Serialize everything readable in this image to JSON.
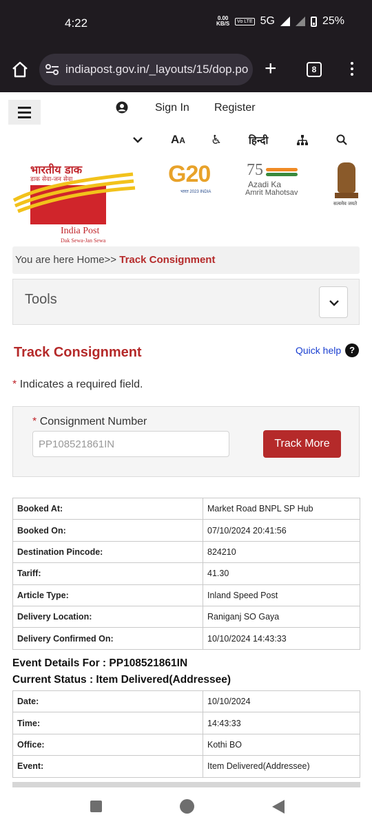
{
  "status_bar": {
    "time": "4:22",
    "speed_value": "0.00",
    "speed_unit": "KB/S",
    "volte": "Vo LTE",
    "network": "5G",
    "battery": "25%"
  },
  "browser": {
    "url": "indiapost.gov.in/_layouts/15/dop.po",
    "tab_count": "8"
  },
  "header": {
    "sign_in": "Sign In",
    "register": "Register",
    "hindi": "हिन्दी",
    "font_icon": "A",
    "access_icon": "♿"
  },
  "logos": {
    "hindi_title": "भारतीय डाक",
    "hindi_tagline": "डाक सेवा-जन सेवा",
    "name": "India Post",
    "tagline": "Dak Sewa-Jan Sewa",
    "g20": "G20",
    "g20_sub": "भारत 2023 INDIA",
    "azadi_75": "75",
    "azadi_line1": "Azadi Ka",
    "azadi_line2": "Amrit Mahotsav",
    "emblem_text": "सत्यमेव जयते"
  },
  "breadcrumb": {
    "prefix": "You are here",
    "home": "Home",
    "sep": ">>",
    "current": "Track Consignment"
  },
  "tools": {
    "label": "Tools"
  },
  "page": {
    "title": "Track Consignment",
    "quick_help": "Quick help",
    "help_glyph": "?",
    "required_star": "*",
    "required_note": "Indicates a required field."
  },
  "form": {
    "star": "*",
    "label": "Consignment Number",
    "value": "PP108521861IN",
    "button": "Track More"
  },
  "booking_rows": [
    {
      "key": "Booked At:",
      "value": "Market Road BNPL SP Hub"
    },
    {
      "key": "Booked On:",
      "value": "07/10/2024 20:41:56"
    },
    {
      "key": "Destination Pincode:",
      "value": "824210"
    },
    {
      "key": "Tariff:",
      "value": "41.30"
    },
    {
      "key": "Article Type:",
      "value": "Inland Speed Post"
    },
    {
      "key": "Delivery Location:",
      "value": "Raniganj SO Gaya"
    },
    {
      "key": "Delivery Confirmed On:",
      "value": "10/10/2024 14:43:33"
    }
  ],
  "event": {
    "details_for": "Event Details For : PP108521861IN",
    "current_status": "Current Status : Item Delivered(Addressee)",
    "rows": [
      {
        "key": "Date:",
        "value": "10/10/2024"
      },
      {
        "key": "Time:",
        "value": "14:43:33"
      },
      {
        "key": "Office:",
        "value": "Kothi BO"
      },
      {
        "key": "Event:",
        "value": "Item Delivered(Addressee)"
      }
    ]
  },
  "colors": {
    "accent_red": "#b52a2a",
    "link_blue": "#1a3fd1",
    "browser_chrome": "#1f1b20"
  }
}
